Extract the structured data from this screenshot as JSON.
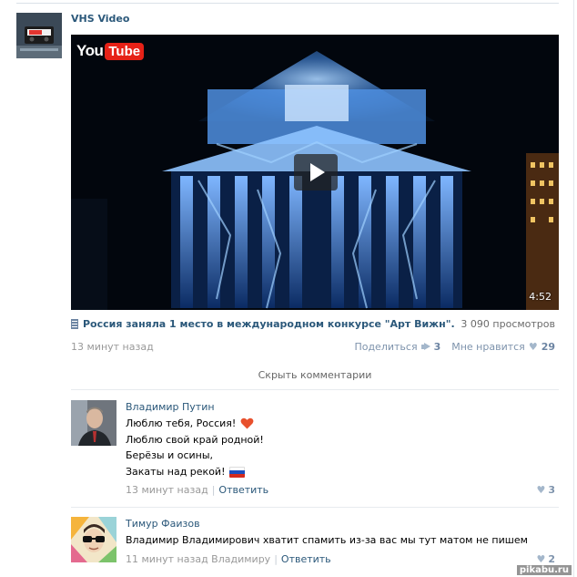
{
  "post": {
    "author": "VHS Video",
    "avatar_icon": "vhs-cassette-icon",
    "video": {
      "provider_logo_you": "You",
      "provider_logo_tube": "Tube",
      "duration": "4:52",
      "title": "Россия заняла 1 место в международном конкурсе \"Арт Вижн\".",
      "views": "3 090 просмотров"
    },
    "time": "13 минут назад",
    "share_label": "Поделиться",
    "share_count": "3",
    "like_label": "Мне нравится",
    "like_count": "29",
    "hide_comments_label": "Скрыть комментарии"
  },
  "comments": [
    {
      "author": "Владимир Путин",
      "lines": [
        "Люблю тебя, Россия!",
        "Люблю свой край родной!",
        "Берёзы и осины,",
        "Закаты над рекой!"
      ],
      "time": "13 минут назад",
      "reply_label": "Ответить",
      "likes": "3"
    },
    {
      "author": "Тимур Фаизов",
      "text": "Владимир Владимирович хватит спамить из-за вас мы тут матом не пишем",
      "time": "11 минут назад Владимиру",
      "reply_label": "Ответить",
      "likes": "2"
    }
  ],
  "watermark": "pikabu.ru",
  "colors": {
    "link": "#2b587a",
    "meta": "#999999",
    "accent_soft": "#a4b7cb",
    "youtube_red": "#e62117",
    "heart_red": "#e8502c"
  }
}
